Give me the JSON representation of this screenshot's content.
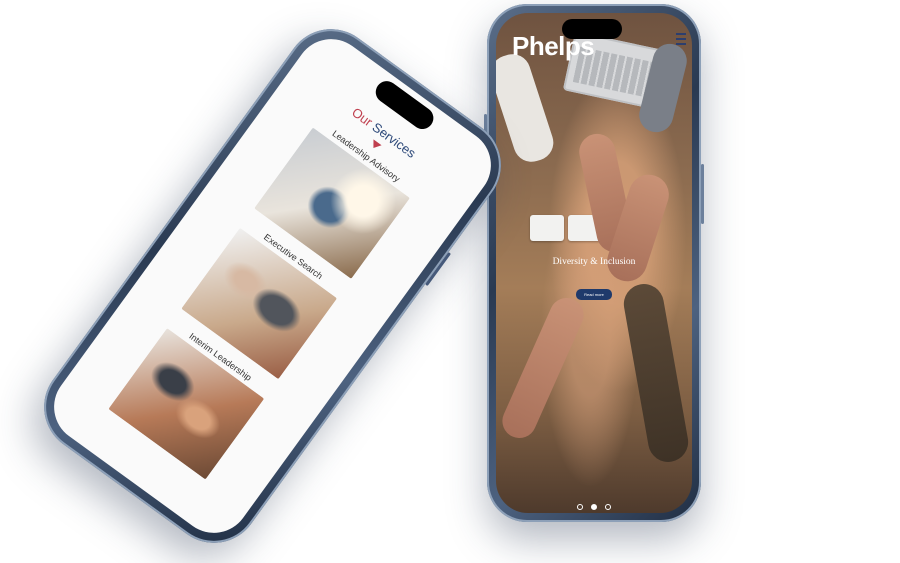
{
  "right_phone": {
    "brand": "Phelps",
    "hero_title": "Diversity & Inclusion",
    "cta_label": "Read more",
    "slider_dots": 3,
    "active_dot": 2,
    "icons": [
      "menu-icon"
    ]
  },
  "left_phone": {
    "section_title_first": "Our",
    "section_title_second": "Services",
    "services": [
      {
        "label": "Leadership Advisory"
      },
      {
        "label": "Executive Search"
      },
      {
        "label": "Interim Leadership"
      }
    ],
    "colors": {
      "accent_red": "#c0404f",
      "accent_blue": "#2e4a7a"
    }
  }
}
